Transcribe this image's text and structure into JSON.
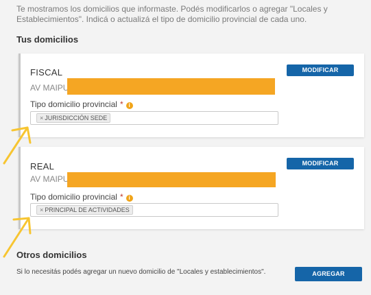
{
  "intro": "Te mostramos los domicilios que informaste. Podés modificarlos o agregar \"Locales y Establecimientos\". Indicá o actualizá el tipo de domicilio provincial de cada uno.",
  "tus_domicilios": {
    "title": "Tus domicilios",
    "cards": [
      {
        "type": "FISCAL",
        "address": "AV MAIPU",
        "field_label": "Tipo domicilio provincial",
        "required_mark": "*",
        "info_icon": "info-icon",
        "tag": "JURISDICCIÓN SEDE",
        "tag_remove": "×",
        "button": "MODIFICAR"
      },
      {
        "type": "REAL",
        "address": "AV MAIPU",
        "field_label": "Tipo domicilio provincial",
        "required_mark": "*",
        "info_icon": "info-icon",
        "tag": "PRINCIPAL DE ACTIVIDADES",
        "tag_remove": "×",
        "button": "MODIFICAR"
      }
    ]
  },
  "otros_domicilios": {
    "title": "Otros domicilios",
    "description": "Si lo necesitás podés agregar un nuevo domicilio de \"Locales y establecimientos\".",
    "button": "AGREGAR"
  },
  "colors": {
    "primary_button": "#1565a8",
    "redaction": "#f5a623",
    "annotation_arrow": "#f7c531",
    "info_icon": "#f0a419"
  }
}
